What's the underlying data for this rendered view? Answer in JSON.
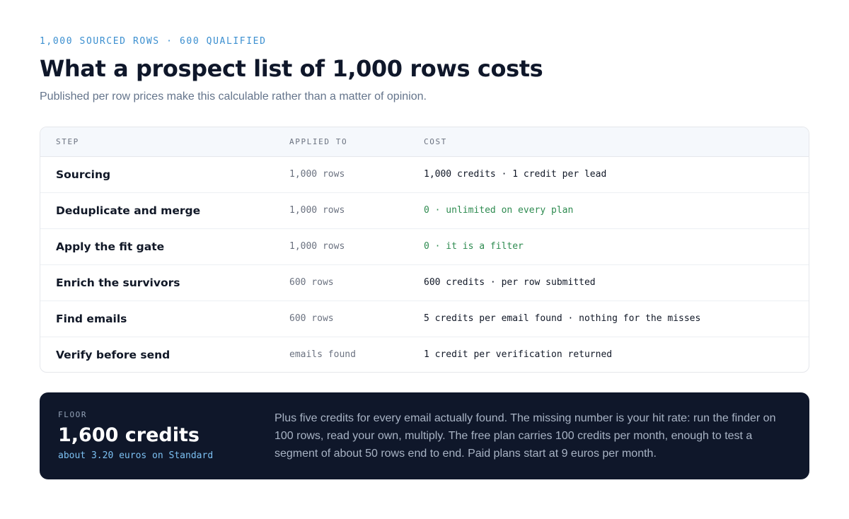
{
  "header": {
    "eyebrow": "1,000 SOURCED ROWS · 600 QUALIFIED",
    "title": "What a prospect list of 1,000 rows costs",
    "subtitle": "Published per row prices make this calculable rather than a matter of opinion."
  },
  "table": {
    "columns": [
      "STEP",
      "APPLIED TO",
      "COST"
    ],
    "rows": [
      {
        "step": "Sourcing",
        "applied_to": "1,000 rows",
        "cost": "1,000 credits · 1 credit per lead",
        "free": false
      },
      {
        "step": "Deduplicate and merge",
        "applied_to": "1,000 rows",
        "cost": "0 · unlimited on every plan",
        "free": true
      },
      {
        "step": "Apply the fit gate",
        "applied_to": "1,000 rows",
        "cost": "0 · it is a filter",
        "free": true
      },
      {
        "step": "Enrich the survivors",
        "applied_to": "600 rows",
        "cost": "600 credits · per row submitted",
        "free": false
      },
      {
        "step": "Find emails",
        "applied_to": "600 rows",
        "cost": "5 credits per email found · nothing for the misses",
        "free": false
      },
      {
        "step": "Verify before send",
        "applied_to": "emails found",
        "cost": "1 credit per verification returned",
        "free": false
      }
    ]
  },
  "floor": {
    "label": "FLOOR",
    "value": "1,600 credits",
    "sub": "about 3.20 euros on Standard",
    "description": "Plus five credits for every email actually found. The missing number is your hit rate: run the finder on 100 rows, read your own, multiply. The free plan carries 100 credits per month, enough to test a segment of about 50 rows end to end. Paid plans start at 9 euros per month."
  },
  "colors": {
    "accent": "#3b8fd0",
    "free_cost": "#2e8b50",
    "panel_bg": "#0f172a"
  }
}
